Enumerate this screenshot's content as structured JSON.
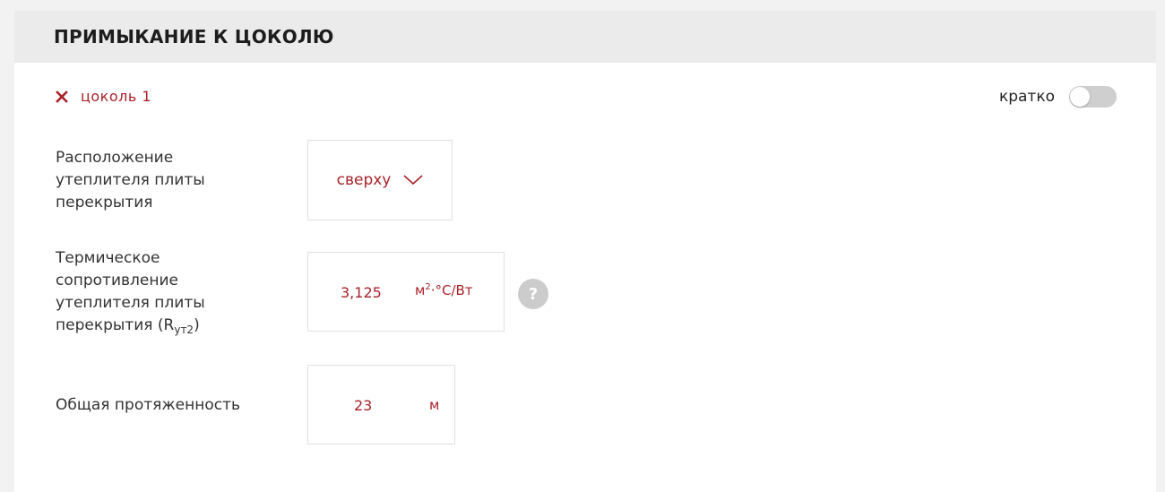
{
  "section": {
    "title": "ПРИМЫКАНИЕ К ЦОКОЛЮ"
  },
  "item": {
    "name": "цоколь 1"
  },
  "brief": {
    "label": "кратко",
    "enabled": false
  },
  "fields": {
    "insulation_position": {
      "label_lines": [
        "Расположение",
        "утеплителя плиты",
        "перекрытия"
      ],
      "value": "сверху"
    },
    "thermal_resistance": {
      "label_lines": [
        "Термическое",
        "сопротивление",
        "утеплителя плиты"
      ],
      "label_last_prefix": "перекрытия (R",
      "label_subscript": "ут2",
      "label_last_suffix": ")",
      "value": "3,125",
      "unit_prefix": "м",
      "unit_sup": "2",
      "unit_suffix": "·°С/Вт",
      "help": "?"
    },
    "total_length": {
      "label": "Общая протяженность",
      "value": "23",
      "unit": "м"
    }
  },
  "colors": {
    "accent": "#a8232a",
    "header_bg": "#ebebeb",
    "toggle_off": "#cfcfcf",
    "help_bg": "#cccccc"
  },
  "icons": {
    "remove": "close-icon",
    "dropdown": "chevron-down-icon",
    "help": "question-icon"
  }
}
